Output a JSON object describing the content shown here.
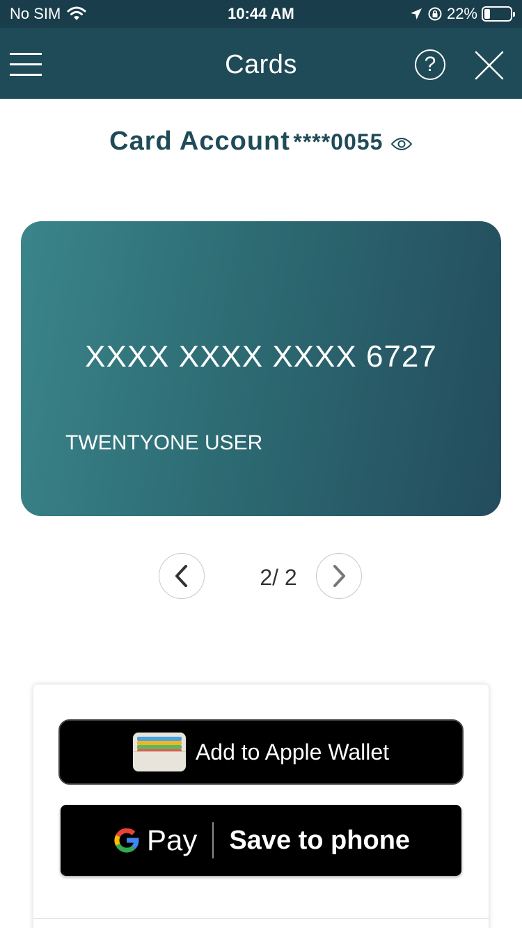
{
  "status_bar": {
    "carrier": "No SIM",
    "time": "10:44 AM",
    "battery_percent": "22%",
    "battery_level": 0.22,
    "icons": [
      "wifi-icon",
      "location-arrow-icon",
      "orientation-lock-icon",
      "battery-icon"
    ]
  },
  "nav": {
    "title": "Cards",
    "menu_icon": "hamburger-menu-icon",
    "help_label": "?",
    "close_icon": "close-icon"
  },
  "account": {
    "label": "Card Account",
    "masked_number": "****0055",
    "visibility_icon": "eye-icon"
  },
  "card": {
    "number": "XXXX XXXX XXXX 6727",
    "holder": "TWENTYONE USER"
  },
  "pager": {
    "current": "2/ 2",
    "prev_icon": "chevron-left-icon",
    "next_icon": "chevron-right-icon"
  },
  "wallet": {
    "apple_label": "Add to Apple Wallet",
    "apple_icon": "apple-wallet-icon",
    "gpay_brand": "Pay",
    "gpay_label": "Save to phone",
    "gpay_icon": "google-g-icon"
  },
  "colors": {
    "header": "#1f4b58",
    "status_bar": "#1a3d4b",
    "accent_text": "#1f4b58",
    "card_start": "#3a858a",
    "card_end": "#234c5c"
  }
}
